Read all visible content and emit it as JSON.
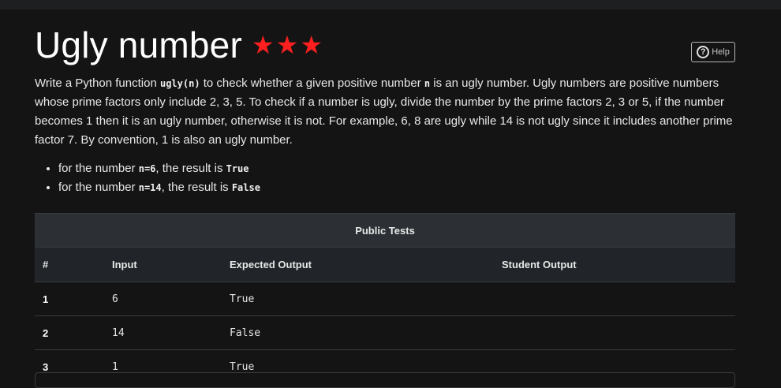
{
  "problem": {
    "title": "Ugly number",
    "stars": "★★★",
    "help_label": "Help",
    "help_icon": "question-circle-icon",
    "description": "Write a Python function ugly(n) to check whether a given positive number n is an ugly number. Ugly numbers are positive numbers whose prime factors only include 2, 3, 5. To check if a number is ugly, divide the number by the prime factors 2, 3 or 5, if the number becomes 1 then it is an ugly number, otherwise it is not. For example, 6, 8 are ugly while 14 is not ugly since it includes another prime factor 7. By convention, 1 is also an ugly number.",
    "desc_parts": {
      "p1": "Write a Python function ",
      "code1": "ugly(n)",
      "p2": " to check whether a given positive number ",
      "code2": "n",
      "p3": " is an ugly number. Ugly numbers are positive numbers whose prime factors only include 2, 3, 5. To check if a number is ugly, divide the number by the prime factors 2, 3 or 5, if the number becomes 1 then it is an ugly number, otherwise it is not. For example, 6, 8 are ugly while 14 is not ugly since it includes another prime factor 7. By convention, 1 is also an ugly number."
    },
    "examples": [
      {
        "prefix": "for the number ",
        "code": "n=6",
        "mid": ", the result is ",
        "result": "True"
      },
      {
        "prefix": "for the number ",
        "code": "n=14",
        "mid": ", the result is ",
        "result": "False"
      }
    ]
  },
  "tests": {
    "caption": "Public Tests",
    "columns": [
      "#",
      "Input",
      "Expected Output",
      "Student Output"
    ],
    "rows": [
      {
        "num": "1",
        "input": "6",
        "expected": "True",
        "student": ""
      },
      {
        "num": "2",
        "input": "14",
        "expected": "False",
        "student": ""
      },
      {
        "num": "3",
        "input": "1",
        "expected": "True",
        "student": ""
      }
    ]
  },
  "colors": {
    "background": "#141414",
    "stars": "#ff1f1f",
    "table_caption_bg": "#2c3034",
    "table_header_bg": "#212529"
  }
}
